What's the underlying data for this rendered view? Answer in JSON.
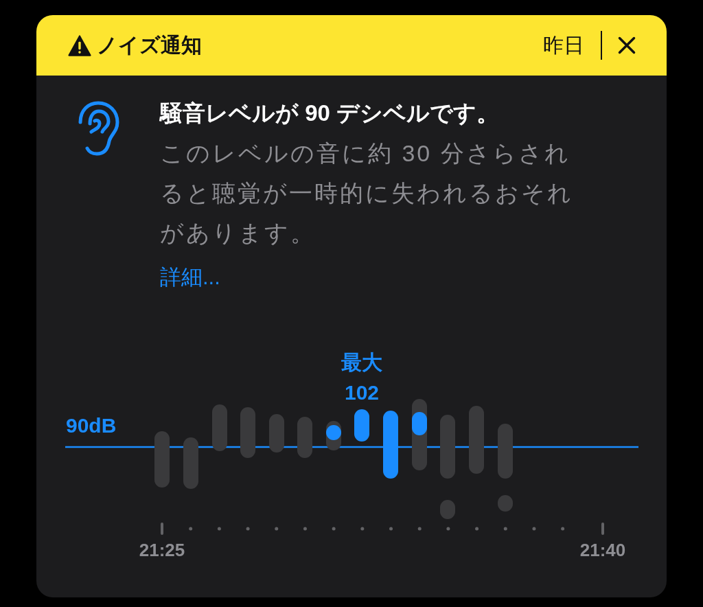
{
  "header": {
    "title": "ノイズ通知",
    "time": "昨日"
  },
  "message": {
    "title": "騒音レベルが 90 デシベルです。",
    "body": "このレベルの音に約 30 分さらされると聴覚が一時的に失われるおそれがあります。",
    "link": "詳細..."
  },
  "chart": {
    "peak_label": "最大",
    "peak_value": "102",
    "threshold_label": "90dB",
    "start_time": "21:25",
    "end_time": "21:40"
  }
}
